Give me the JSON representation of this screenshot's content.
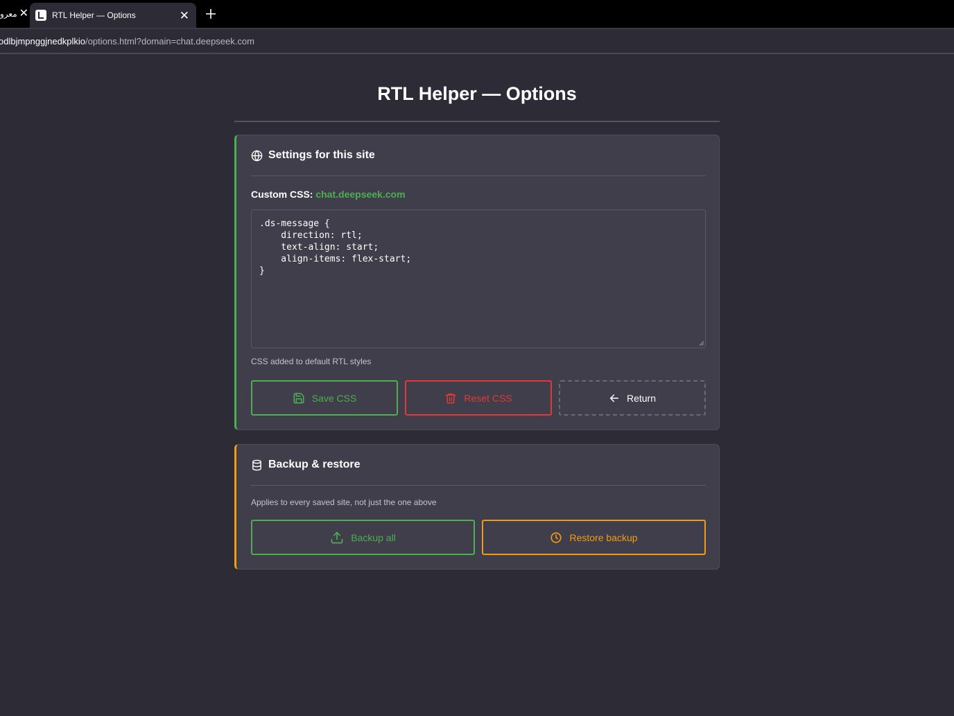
{
  "browser": {
    "prev_tab_label": "معرو",
    "active_tab_title": "RTL Helper — Options",
    "url_host": "odlbjmpnggjnedkplkio",
    "url_path": "/options.html?domain=chat.deepseek.com"
  },
  "page": {
    "title": "RTL Helper — Options"
  },
  "settings": {
    "heading": "Settings for this site",
    "custom_css_label": "Custom CSS:",
    "domain": "chat.deepseek.com",
    "css_value": ".ds-message {\n    direction: rtl;\n    text-align: start;\n    align-items: flex-start;\n}",
    "hint": "CSS added to default RTL styles",
    "save_label": "Save CSS",
    "reset_label": "Reset CSS",
    "return_label": "Return"
  },
  "backup": {
    "heading": "Backup & restore",
    "hint": "Applies to every saved site, not just the one above",
    "backup_label": "Backup all",
    "restore_label": "Restore backup"
  },
  "colors": {
    "background": "#2c2b36",
    "card": "#3f3e4a",
    "accent_green": "#4caf50",
    "accent_red": "#e53935",
    "accent_orange": "#f39c12"
  },
  "icons": {
    "settings_heading": "globe-icon",
    "backup_heading": "database-icon",
    "save": "floppy-disk-icon",
    "reset": "trash-icon",
    "return": "arrow-left-icon",
    "backup_all": "upload-icon",
    "restore": "clock-icon"
  }
}
